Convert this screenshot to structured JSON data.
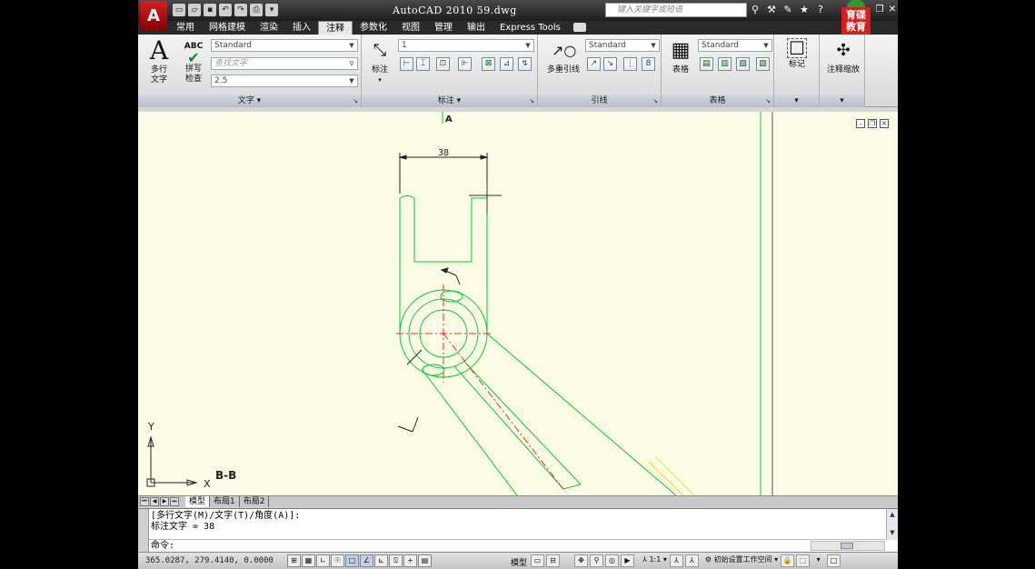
{
  "app": {
    "logo_letter": "A",
    "title": "AutoCAD 2010   59.dwg",
    "search_placeholder": "键入关键字或短语",
    "brand_logo": "育碟教育"
  },
  "quick_access": [
    "new-icon",
    "open-icon",
    "save-icon",
    "undo-icon",
    "redo-icon",
    "plot-icon",
    "dropdown-icon"
  ],
  "tabs": [
    "常用",
    "网格建模",
    "渲染",
    "插入",
    "注释",
    "参数化",
    "视图",
    "管理",
    "输出",
    "Express Tools"
  ],
  "active_tab": "注释",
  "ribbon": {
    "text_panel": {
      "title": "文字",
      "mtext_label_1": "多行",
      "mtext_label_2": "文字",
      "spell_label_1": "拼写",
      "spell_label_2": "检查",
      "abc": "ABC",
      "style_value": "Standard",
      "find_placeholder": "查找文字",
      "height_value": "2.5"
    },
    "dim_panel": {
      "title": "标注",
      "dim_label": "标注",
      "dimstyle_value": "1"
    },
    "leader_panel": {
      "title": "引线",
      "mleader_label": "多重引线",
      "mleaderstyle_value": "Standard"
    },
    "table_panel": {
      "title": "表格",
      "table_label": "表格",
      "tablestyle_value": "Standard"
    },
    "markup_panel": {
      "label": "标记"
    },
    "scale_panel": {
      "label": "注释缩放"
    }
  },
  "drawing": {
    "dimension_text": "38",
    "section_label_top": "A",
    "section_label_bottom": "B-B",
    "ucs_x": "X",
    "ucs_y": "Y",
    "colors": {
      "geometry": "#00cc33",
      "centerline": "#ff2222",
      "cursor": "#333333",
      "background": "#fbfbe6",
      "yellow_line": "#e6e600"
    }
  },
  "layout_tabs": [
    "模型",
    "布局1",
    "布局2"
  ],
  "command": {
    "line1": "[多行文字(M)/文字(T)/角度(A)]:",
    "line2": "标注文字 = 38",
    "prompt": "命令:"
  },
  "status": {
    "coords": "365.0287, 279.4140, 0.0000",
    "model_label": "模型",
    "annotation_scale": "1:1",
    "workspace": "初始设置工作空间"
  }
}
